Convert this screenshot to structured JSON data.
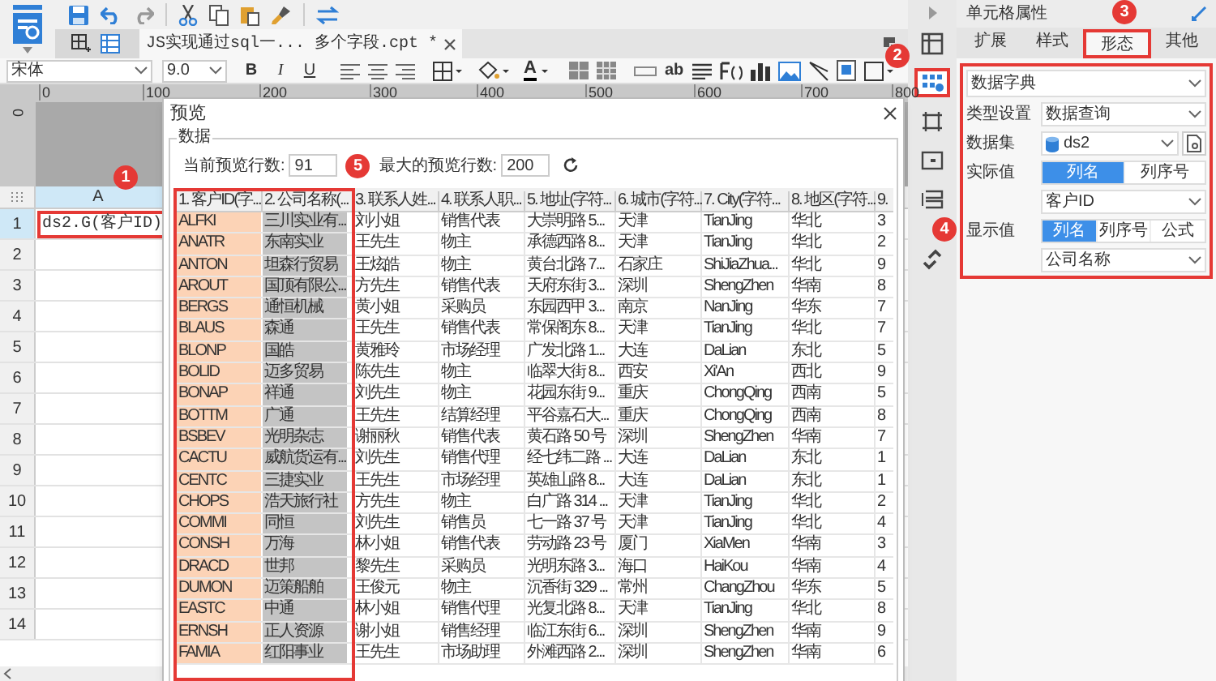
{
  "toolbar": {
    "file_tab": "JS实现通过sql一... 多个字段.cpt *"
  },
  "format_bar": {
    "font": "宋体",
    "size": "9.0",
    "text_buttons": [
      "B",
      "I",
      "U"
    ],
    "font_color": "A",
    "text_tool": "ab"
  },
  "ruler": {
    "marks": [
      "0",
      "100",
      "200",
      "300",
      "400",
      "500",
      "600",
      "700",
      "800"
    ],
    "vertical_mark": "0"
  },
  "sheet": {
    "columns": [
      {
        "label": "A",
        "selected": true
      }
    ],
    "rows": [
      {
        "label": "1",
        "selected": true,
        "cell": "ds2.G(客户ID)"
      },
      {
        "label": "2",
        "selected": false
      },
      {
        "label": "3",
        "selected": false
      },
      {
        "label": "4",
        "selected": false
      },
      {
        "label": "5",
        "selected": false
      },
      {
        "label": "6",
        "selected": false
      },
      {
        "label": "7",
        "selected": false
      },
      {
        "label": "8",
        "selected": false
      },
      {
        "label": "9",
        "selected": false
      },
      {
        "label": "10",
        "selected": false
      },
      {
        "label": "11",
        "selected": false
      },
      {
        "label": "12",
        "selected": false
      },
      {
        "label": "13",
        "selected": false
      },
      {
        "label": "14",
        "selected": false
      }
    ]
  },
  "dialog": {
    "title": "预览",
    "group": "数据",
    "current_rows_label": "当前预览行数:",
    "current_rows": "91",
    "max_rows_label": "最大的预览行数:",
    "max_rows": "200",
    "columns": [
      {
        "label": "1. 客户ID(字...",
        "kind": "actual"
      },
      {
        "label": "2. 公司名称(...",
        "kind": "display"
      },
      {
        "label": "3. 联系人姓...",
        "kind": "plain"
      },
      {
        "label": "4. 联系人职...",
        "kind": "plain"
      },
      {
        "label": "5. 地址(字符...",
        "kind": "plain"
      },
      {
        "label": "6. 城市(字符...",
        "kind": "plain"
      },
      {
        "label": "7. City(字符...",
        "kind": "plain"
      },
      {
        "label": "8. 地区(字符...",
        "kind": "plain"
      },
      {
        "label": "9.",
        "kind": "plain"
      }
    ],
    "rows": [
      [
        "ALFKI",
        "三川实业有...",
        "刘小姐",
        "销售代表",
        "大崇明路 5...",
        "天津",
        "TianJing",
        "华北",
        "3"
      ],
      [
        "ANATR",
        "东南实业",
        "王先生",
        "物主",
        "承德西路 8...",
        "天津",
        "TianJing",
        "华北",
        "2"
      ],
      [
        "ANTON",
        "坦森行贸易",
        "王炫皓",
        "物主",
        "黄台北路 7...",
        "石家庄",
        "ShiJiaZhua...",
        "华北",
        "9"
      ],
      [
        "AROUT",
        "国顶有限公...",
        "方先生",
        "销售代表",
        "天府东街 3...",
        "深圳",
        "ShengZhen",
        "华南",
        "8"
      ],
      [
        "BERGS",
        "通恒机械",
        "黄小姐",
        "采购员",
        "东园西甲 3...",
        "南京",
        "NanJing",
        "华东",
        "7"
      ],
      [
        "BLAUS",
        "森通",
        "王先生",
        "销售代表",
        "常保阁东 8...",
        "天津",
        "TianJing",
        "华北",
        "7"
      ],
      [
        "BLONP",
        "国皓",
        "黄雅玲",
        "市场经理",
        "广发北路 1...",
        "大连",
        "DaLian",
        "东北",
        "5"
      ],
      [
        "BOLID",
        "迈多贸易",
        "陈先生",
        "物主",
        "临翠大街 8...",
        "西安",
        "Xi'An",
        "西北",
        "9"
      ],
      [
        "BONAP",
        "祥通",
        "刘先生",
        "物主",
        "花园东街 9...",
        "重庆",
        "ChongQing",
        "西南",
        "5"
      ],
      [
        "BOTTM",
        "广通",
        "王先生",
        "结算经理",
        "平谷嘉石大...",
        "重庆",
        "ChongQing",
        "西南",
        "8"
      ],
      [
        "BSBEV",
        "光明杂志",
        "谢丽秋",
        "销售代表",
        "黄石路 50 号",
        "深圳",
        "ShengZhen",
        "华南",
        "7"
      ],
      [
        "CACTU",
        "威航货运有...",
        "刘先生",
        "销售代理",
        "经七纬二路 ...",
        "大连",
        "DaLian",
        "东北",
        "1"
      ],
      [
        "CENTC",
        "三捷实业",
        "王先生",
        "市场经理",
        "英雄山路 8...",
        "大连",
        "DaLian",
        "东北",
        "1"
      ],
      [
        "CHOPS",
        "浩天旅行社",
        "方先生",
        "物主",
        "白广路 314 ...",
        "天津",
        "TianJing",
        "华北",
        "2"
      ],
      [
        "COMMI",
        "同恒",
        "刘先生",
        "销售员",
        "七一路 37 号",
        "天津",
        "TianJing",
        "华北",
        "4"
      ],
      [
        "CONSH",
        "万海",
        "林小姐",
        "销售代表",
        "劳动路 23 号",
        "厦门",
        "XiaMen",
        "华南",
        "3"
      ],
      [
        "DRACD",
        "世邦",
        "黎先生",
        "采购员",
        "光明东路 3...",
        "海口",
        "HaiKou",
        "华南",
        "4"
      ],
      [
        "DUMON",
        "迈策船舶",
        "王俊元",
        "物主",
        "沉香街 329 ...",
        "常州",
        "ChangZhou",
        "华东",
        "5"
      ],
      [
        "EASTC",
        "中通",
        "林小姐",
        "销售代理",
        "光复北路 8...",
        "天津",
        "TianJing",
        "华北",
        "8"
      ],
      [
        "ERNSH",
        "正人资源",
        "谢小姐",
        "销售经理",
        "临江东街 6...",
        "深圳",
        "ShengZhen",
        "华南",
        "9"
      ],
      [
        "FAMIA",
        "红阳事业",
        "王先生",
        "市场助理",
        "外滩西路 2...",
        "深圳",
        "ShengZhen",
        "华南",
        "6"
      ]
    ]
  },
  "side_icons": [
    {
      "kind": "cell",
      "selected": false
    },
    {
      "kind": "widget",
      "selected": true
    },
    {
      "kind": "frame",
      "selected": false
    },
    {
      "kind": "form",
      "selected": false
    },
    {
      "kind": "list",
      "selected": false
    },
    {
      "kind": "link",
      "selected": false
    }
  ],
  "panel": {
    "title": "单元格属性",
    "tabs": [
      {
        "label": "扩展",
        "selected": false
      },
      {
        "label": "样式",
        "selected": false
      },
      {
        "label": "形态",
        "selected": true
      },
      {
        "label": "其他",
        "selected": false
      }
    ],
    "widget_type": "数据字典",
    "fields": [
      {
        "kind": "select",
        "label": "类型设置",
        "value": "数据查询"
      },
      {
        "kind": "dataset",
        "label": "数据集",
        "value": "ds2"
      },
      {
        "kind": "segmented",
        "label": "实际值",
        "options": [
          {
            "label": "列名",
            "selected": true
          },
          {
            "label": "列序号",
            "selected": false
          }
        ],
        "value": "客户ID"
      },
      {
        "kind": "segmented",
        "label": "显示值",
        "options": [
          {
            "label": "列名",
            "selected": true
          },
          {
            "label": "列序号",
            "selected": false
          },
          {
            "label": "公式",
            "selected": false
          }
        ],
        "value": "公司名称"
      }
    ]
  },
  "callouts": [
    {
      "label": "1",
      "kind": "cell"
    },
    {
      "label": "2",
      "kind": "side_icon"
    },
    {
      "label": "3",
      "kind": "tab"
    },
    {
      "label": "4",
      "kind": "form"
    },
    {
      "label": "5",
      "kind": "columns"
    }
  ]
}
